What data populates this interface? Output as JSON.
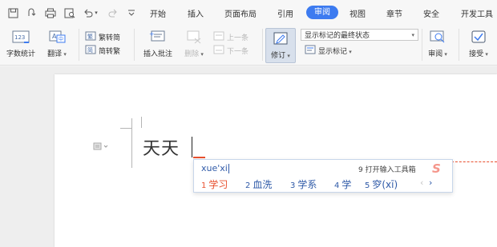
{
  "menubar": {
    "quick_access": [
      "save-icon",
      "redo-history-icon",
      "print-icon",
      "print-preview-icon",
      "undo-icon",
      "redo-icon",
      "customize-icon"
    ],
    "tabs": [
      {
        "label": "开始"
      },
      {
        "label": "插入"
      },
      {
        "label": "页面布局"
      },
      {
        "label": "引用"
      },
      {
        "label": "审阅"
      },
      {
        "label": "视图"
      },
      {
        "label": "章节"
      },
      {
        "label": "安全"
      },
      {
        "label": "开发工具"
      }
    ],
    "active_tab": "审阅",
    "accent_color": "#3d7bf0"
  },
  "ribbon": {
    "word_count": "字数统计",
    "translate": "翻译",
    "trad_to_simp": "繁转简",
    "simp_to_trad": "简转繁",
    "insert_comment": "插入批注",
    "delete": "删除",
    "previous": "上一条",
    "next": "下一条",
    "track_changes": "修订",
    "markup_mode": "显示标记的最终状态",
    "show_markup": "显示标记",
    "review": "审阅",
    "accept": "接受"
  },
  "document": {
    "text": "天天"
  },
  "ime": {
    "pinyin": "xue'xi",
    "toolbox_label": "9 打开输入工具箱",
    "candidates": [
      {
        "num": "1",
        "text": "学习"
      },
      {
        "num": "2",
        "text": "血洗"
      },
      {
        "num": "3",
        "text": "学系"
      },
      {
        "num": "4",
        "text": "学"
      },
      {
        "num": "5",
        "text": "穸(xī)"
      }
    ],
    "prev_label": "‹",
    "next_label": "›",
    "highlight_color": "#e8502e"
  }
}
